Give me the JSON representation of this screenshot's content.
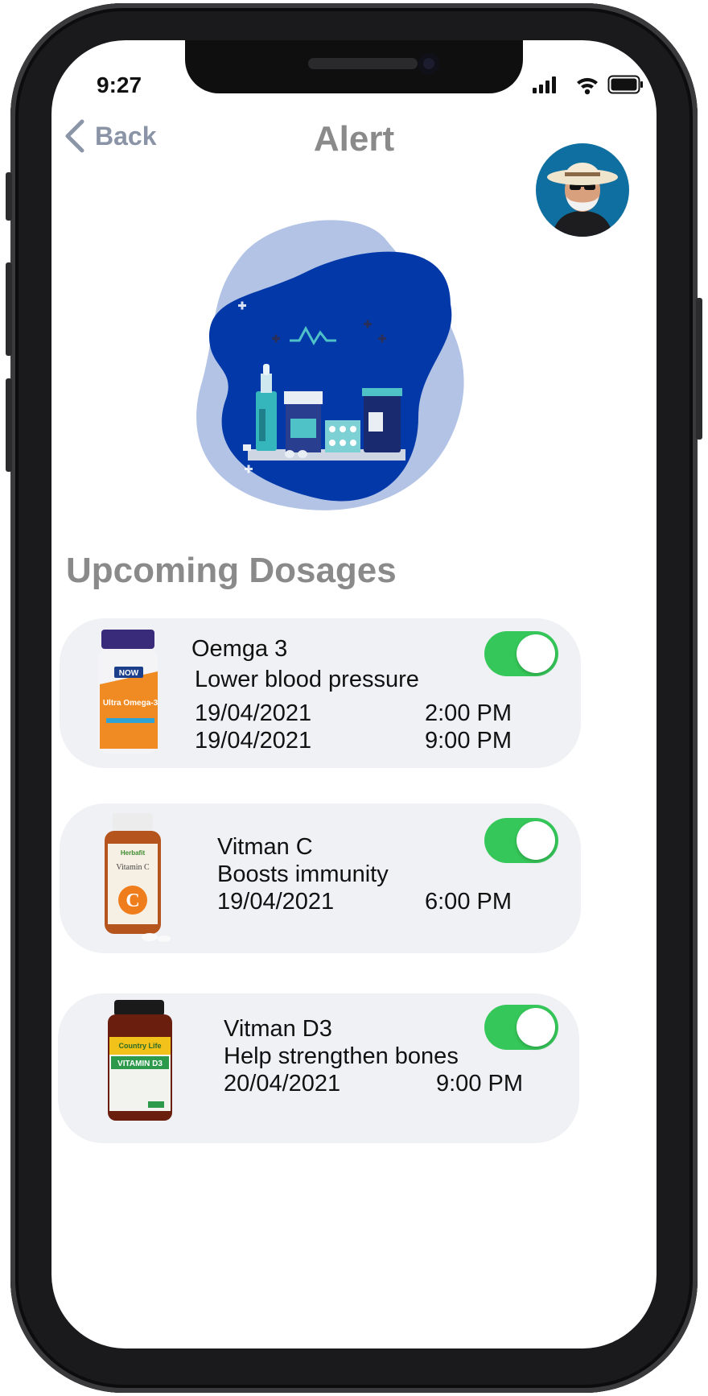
{
  "status_bar": {
    "time": "9:27"
  },
  "header": {
    "back_label": "Back",
    "title": "Alert"
  },
  "section": {
    "title": "Upcoming Dosages"
  },
  "dosages": [
    {
      "name": "Oemga 3",
      "description": "Lower blood pressure",
      "schedule": [
        {
          "date": "19/04/2021",
          "time": "2:00 PM"
        },
        {
          "date": "19/04/2021",
          "time": "9:00 PM"
        }
      ],
      "enabled": true,
      "bottle_brand": "NOW",
      "bottle_label": "Ultra Omega-3"
    },
    {
      "name": "Vitman C",
      "description": "Boosts immunity",
      "schedule": [
        {
          "date": "19/04/2021",
          "time": "6:00 PM"
        }
      ],
      "enabled": true,
      "bottle_brand": "Herbafit",
      "bottle_label": "Vitamin C"
    },
    {
      "name": "Vitman D3",
      "description": "Help strengthen bones",
      "schedule": [
        {
          "date": "20/04/2021",
          "time": "9:00 PM"
        }
      ],
      "enabled": true,
      "bottle_brand": "Country Life",
      "bottle_label": "VITAMIN D3"
    }
  ],
  "colors": {
    "toggle_on": "#35c759",
    "card_bg": "#f0f1f5",
    "accent_blue": "#0238a8",
    "blob_light": "#b2c3e6"
  }
}
